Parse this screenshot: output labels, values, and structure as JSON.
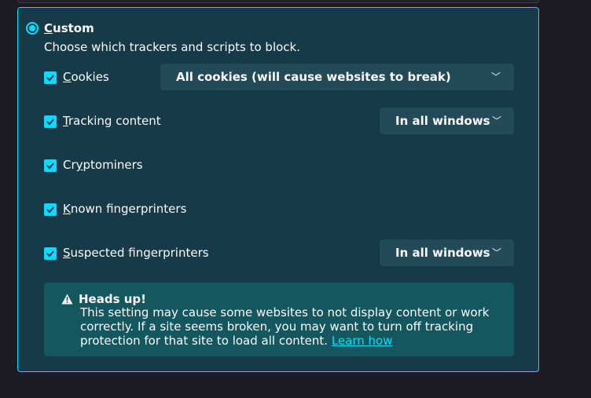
{
  "custom": {
    "title_first": "C",
    "title_rest": "ustom",
    "description": "Choose which trackers and scripts to block."
  },
  "rows": [
    {
      "key_pre": "",
      "key": "C",
      "rest": "ookies",
      "checked": true,
      "select": "All cookies (will cause websites to break)"
    },
    {
      "key_pre": "",
      "key": "T",
      "rest": "racking content",
      "checked": true,
      "select": "In all windows"
    },
    {
      "key_pre": "Cr",
      "key": "y",
      "rest": "ptominers",
      "checked": true
    },
    {
      "key_pre": "",
      "key": "K",
      "rest": "nown fingerprinters",
      "checked": true
    },
    {
      "key_pre": "",
      "key": "S",
      "rest": "uspected fingerprinters",
      "checked": true,
      "select": "In all windows"
    }
  ],
  "alert": {
    "title": "Heads up!",
    "text": "This setting may cause some websites to not display content or work correctly. If a site seems broken, you may want to turn off tracking protection for that site to load all content.",
    "link": "Learn how"
  },
  "colors": {
    "accent": "#00ddff",
    "panel_bg": "#173a48",
    "alert_bg": "#14575f",
    "page_bg": "#1c1b22"
  }
}
